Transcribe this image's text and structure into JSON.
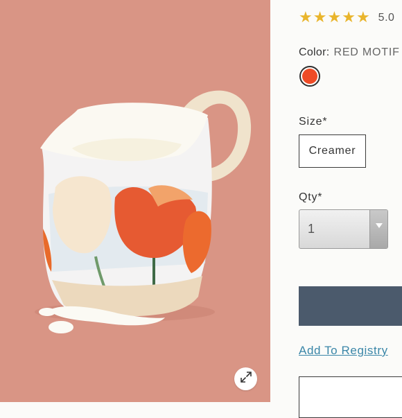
{
  "product": {
    "rating": {
      "value": "5.0",
      "stars": 5,
      "max_stars": 5
    },
    "color": {
      "label": "Color:",
      "value": "RED MOTIF",
      "swatch": "#ee4b26"
    },
    "size": {
      "label": "Size*",
      "selected": "Creamer"
    },
    "qty": {
      "label": "Qty*",
      "value": "1"
    },
    "add_to_bag": {
      "label": ""
    },
    "registry_link": "Add To Registry"
  },
  "gallery": {
    "background": "#d99585",
    "zoom_icon": "expand-icon"
  },
  "colors": {
    "accent": "#4b5a6c",
    "link": "#3a86a8",
    "star": "#e9b52c"
  }
}
